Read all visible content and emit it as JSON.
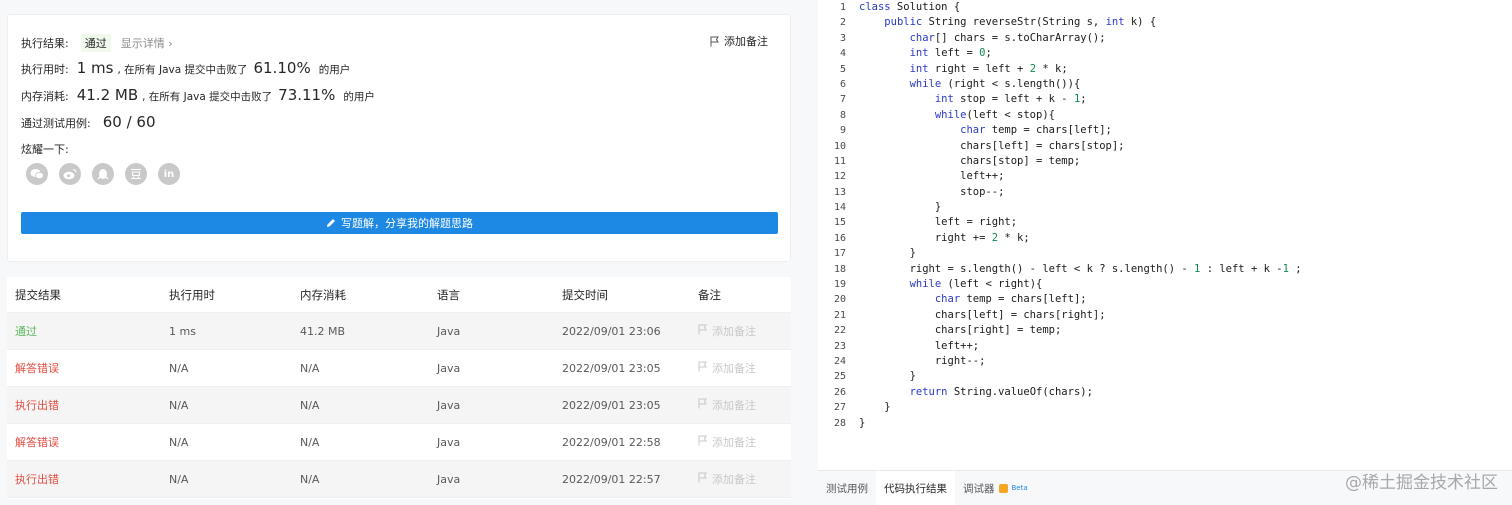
{
  "result": {
    "exec_result_label": "执行结果:",
    "status": "通过",
    "show_detail": "显示详情",
    "add_note": "添加备注",
    "time_label": "执行用时:",
    "time_value": "1 ms",
    "time_text": ", 在所有 Java 提交中击败了",
    "time_pct": "61.10%",
    "time_suffix": "的用户",
    "mem_label": "内存消耗:",
    "mem_value": "41.2 MB",
    "mem_text": ", 在所有 Java 提交中击败了",
    "mem_pct": "73.11%",
    "mem_suffix": "的用户",
    "cases_label": "通过测试用例:",
    "cases_value": "60 / 60",
    "share_label": "炫耀一下:",
    "share_icons": [
      "wechat-icon",
      "weibo-icon",
      "qq-icon",
      "douban-icon",
      "linkedin-icon"
    ],
    "write_solution": "写题解，分享我的解题思路"
  },
  "table": {
    "headers": [
      "提交结果",
      "执行用时",
      "内存消耗",
      "语言",
      "提交时间",
      "备注"
    ],
    "rows": [
      {
        "result": "通过",
        "status": "pass",
        "time": "1 ms",
        "memory": "41.2 MB",
        "lang": "Java",
        "submitted": "2022/09/01 23:06",
        "note": "添加备注"
      },
      {
        "result": "解答错误",
        "status": "fail",
        "time": "N/A",
        "memory": "N/A",
        "lang": "Java",
        "submitted": "2022/09/01 23:05",
        "note": "添加备注"
      },
      {
        "result": "执行出错",
        "status": "fail",
        "time": "N/A",
        "memory": "N/A",
        "lang": "Java",
        "submitted": "2022/09/01 23:05",
        "note": "添加备注"
      },
      {
        "result": "解答错误",
        "status": "fail",
        "time": "N/A",
        "memory": "N/A",
        "lang": "Java",
        "submitted": "2022/09/01 22:58",
        "note": "添加备注"
      },
      {
        "result": "执行出错",
        "status": "fail",
        "time": "N/A",
        "memory": "N/A",
        "lang": "Java",
        "submitted": "2022/09/01 22:57",
        "note": "添加备注"
      }
    ]
  },
  "editor": {
    "lines": [
      "class Solution {",
      "    public String reverseStr(String s, int k) {",
      "        char[] chars = s.toCharArray();",
      "        int left = 0;",
      "        int right = left + 2 * k;",
      "        while (right < s.length()){",
      "            int stop = left + k - 1;",
      "            while(left < stop){",
      "                char temp = chars[left];",
      "                chars[left] = chars[stop];",
      "                chars[stop] = temp;",
      "                left++;",
      "                stop--;",
      "            }",
      "            left = right;",
      "            right += 2 * k;",
      "        }",
      "        right = s.length() - left < k ? s.length() - 1 : left + k -1 ;",
      "        while (left < right){",
      "            char temp = chars[left];",
      "            chars[left] = chars[right];",
      "            chars[right] = temp;",
      "            left++;",
      "            right--;",
      "        }",
      "        return String.valueOf(chars);",
      "    }",
      "}"
    ]
  },
  "bottom_tabs": {
    "testcase": "测试用例",
    "run_result": "代码执行结果",
    "debugger": "调试器",
    "beta": "Beta"
  },
  "watermark": "@稀土掘金技术社区",
  "colors": {
    "accent": "#1e88e5",
    "pass": "#5cb85c",
    "fail": "#e54d42"
  }
}
